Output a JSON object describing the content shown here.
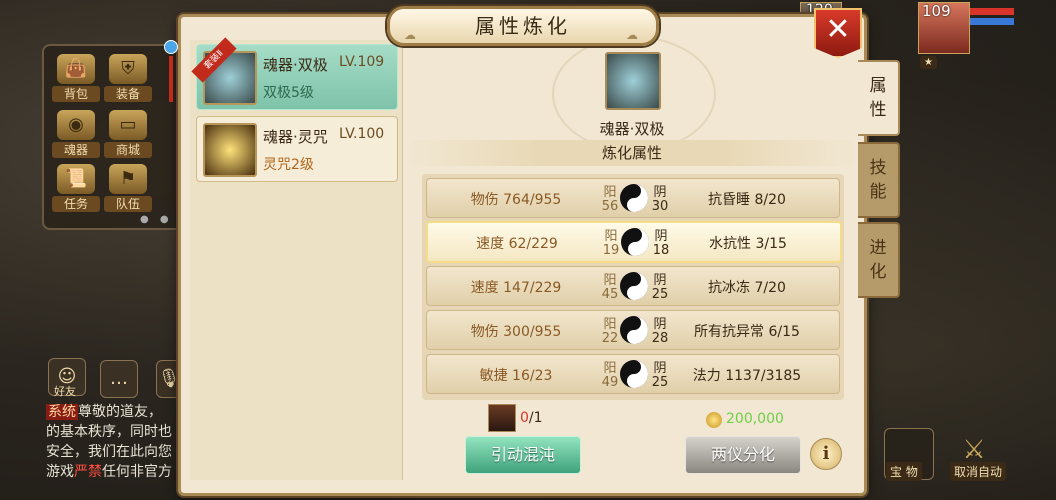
{
  "menu": {
    "items": [
      {
        "label": "背包",
        "icon": "bag-icon"
      },
      {
        "label": "装备",
        "icon": "armor-icon"
      },
      {
        "label": "魂器",
        "icon": "orb-icon"
      },
      {
        "label": "商城",
        "icon": "gold-ingot-icon"
      },
      {
        "label": "任务",
        "icon": "scroll-icon"
      },
      {
        "label": "队伍",
        "icon": "flag-icon"
      }
    ]
  },
  "social": {
    "friend_label": "好友"
  },
  "chat": {
    "tag": "系统",
    "line1": "尊敬的道友，",
    "line2": "的基本秩序，同时也",
    "line3": "安全，我们在此向您",
    "line4_prefix": "游戏",
    "line4_red": "严禁",
    "line4_suffix": "任何非官方"
  },
  "player": {
    "level_main": "109",
    "level_other": "120"
  },
  "side_buttons": {
    "treasure_label": "宝 物",
    "auto_label": "取消自动"
  },
  "dialog": {
    "title": "属性炼化",
    "close_symbol": "✕",
    "tabs": [
      {
        "line1": "属",
        "line2": "性"
      },
      {
        "line1": "技",
        "line2": "能"
      },
      {
        "line1": "进",
        "line2": "化"
      }
    ],
    "items": [
      {
        "ribbon": "套装Ⅱ",
        "name": "魂器·双极",
        "level": "LV.109",
        "sub": "双极5级"
      },
      {
        "name": "魂器·灵咒",
        "level": "LV.100",
        "sub": "灵咒2级"
      }
    ],
    "selected_name": "魂器·双极",
    "section_title": "炼化属性",
    "yang_label": "阳",
    "yin_label": "阴",
    "rows": [
      {
        "left": "物伤 764/955",
        "yang": "56",
        "yin": "30",
        "right": "抗昏睡 8/20"
      },
      {
        "left": "速度 62/229",
        "yang": "19",
        "yin": "18",
        "right": "水抗性 3/15"
      },
      {
        "left": "速度 147/229",
        "yang": "45",
        "yin": "25",
        "right": "抗冰冻 7/20"
      },
      {
        "left": "物伤 300/955",
        "yang": "22",
        "yin": "28",
        "right": "所有抗异常 6/15"
      },
      {
        "left": "敏捷 16/23",
        "yang": "49",
        "yin": "25",
        "right": "法力 1137/3185"
      }
    ],
    "cost_have": "0",
    "cost_need": "/1",
    "coin_amount": "200,000",
    "btn_chaos": "引动混沌",
    "btn_split": "两仪分化",
    "info_symbol": "i"
  }
}
